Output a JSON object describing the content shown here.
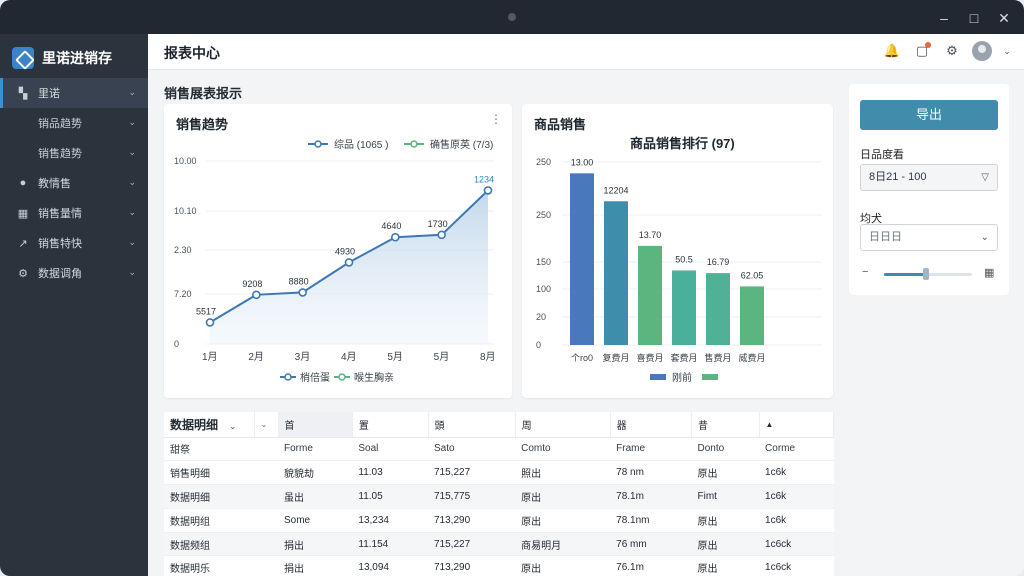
{
  "brand": {
    "name": "里诺进销存"
  },
  "page_title": "报表中心",
  "sidebar": {
    "items": [
      {
        "label": "里诺",
        "icon": "dashboard-icon",
        "active": true,
        "sub": false
      },
      {
        "label": "销品趋势",
        "icon": "",
        "active": false,
        "sub": true
      },
      {
        "label": "销售趋势",
        "icon": "",
        "active": false,
        "sub": true
      },
      {
        "label": "教情售",
        "icon": "user-icon",
        "active": false,
        "sub": false
      },
      {
        "label": "销售量情",
        "icon": "grid-icon",
        "active": false,
        "sub": false
      },
      {
        "label": "销售特快",
        "icon": "trend-icon",
        "active": false,
        "sub": false
      },
      {
        "label": "数据调角",
        "icon": "gear-icon",
        "active": false,
        "sub": false
      }
    ]
  },
  "section_title": "销售展表报示",
  "line_card": {
    "title": "销售趋势",
    "more": "⋮",
    "legend_top": [
      "综品 (1065 )",
      "确售原英 (7/3)"
    ],
    "legend_bottom": [
      "梢倍蛋",
      "喉生胸亲"
    ]
  },
  "bar_card": {
    "title": "商品销售",
    "chart_title": "商品销售排行 (97)",
    "legend": [
      "刚前",
      ""
    ]
  },
  "chart_data": [
    {
      "type": "area",
      "x": [
        "1月",
        "2月",
        "3月",
        "4月",
        "5月",
        "5月",
        "8月"
      ],
      "y_tick_labels": [
        "0",
        "7.20",
        "2.30",
        "10.10",
        "10.00"
      ],
      "points": [
        {
          "label": "5517",
          "y": 0.9
        },
        {
          "label": "9208",
          "y": 2.05
        },
        {
          "label": "8880",
          "y": 2.15
        },
        {
          "label": "4930",
          "y": 3.4
        },
        {
          "label": "4640",
          "y": 4.45
        },
        {
          "label": "1730",
          "y": 4.55
        },
        {
          "label": "1234",
          "y": 6.4
        }
      ],
      "label_color_last": "#2f86b8",
      "line_color": "#3d78b6"
    },
    {
      "type": "bar",
      "title": "商品销售排行 (97)",
      "categories": [
        "个ro0",
        "复费月",
        "喜费月",
        "套费月",
        "售费月",
        "威费月"
      ],
      "values": [
        258,
        216,
        149,
        112,
        108,
        88
      ],
      "data_labels": [
        "13.00",
        "12204",
        "13.70",
        "50.5",
        "16.79",
        "62.05"
      ],
      "y_ticks": [
        0,
        20,
        100,
        150,
        200,
        250
      ],
      "y_tick_labels": [
        "0",
        "20",
        "100",
        "150",
        "250",
        "250"
      ],
      "colors": [
        "#4a78bd",
        "#3e8eab",
        "#5ab57f",
        "#4aaf9b",
        "#4fb195",
        "#5ab57f"
      ]
    }
  ],
  "right_panel": {
    "export_label": "导出",
    "date_label": "日品度看",
    "date_value": "8日21 - 100",
    "type_label": "均犬",
    "type_value": "日日日"
  },
  "table": {
    "tab_label": "数据明细",
    "headers": [
      "首",
      "置",
      "頭",
      "周",
      "器",
      "昔",
      "▲"
    ],
    "rows": [
      {
        "cells": [
          "甜祭",
          "Forme",
          "Soal",
          "Sato",
          "Comto",
          "Frame",
          "Donto",
          "Corme"
        ],
        "kind": "sub"
      },
      {
        "cells": [
          "销售明细",
          "貌貌劫",
          "11.03",
          "715,227",
          "照出",
          "78 nm",
          "原出",
          "1c6k"
        ],
        "kind": "row"
      },
      {
        "cells": [
          "数据明细",
          "虽出",
          "11.05",
          "715,775",
          "原出",
          "78.1m",
          "Fimt",
          "1c6k"
        ],
        "kind": "stripe"
      },
      {
        "cells": [
          "数据明组",
          "Some",
          "13,234",
          "713,290",
          "原出",
          "78.1nm",
          "原出",
          "1c6k"
        ],
        "kind": "row"
      },
      {
        "cells": [
          "数据频组",
          "捐出",
          "11.154",
          "715,227",
          "商易明月",
          "76 mm",
          "原出",
          "1c6ck"
        ],
        "kind": "stripe"
      },
      {
        "cells": [
          "数据明乐",
          "捐出",
          "13,094",
          "713,290",
          "原出",
          "76.1m",
          "原出",
          "1c6ck"
        ],
        "kind": "row"
      }
    ]
  }
}
